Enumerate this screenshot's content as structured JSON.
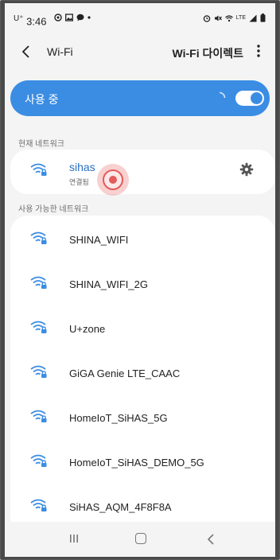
{
  "status_bar": {
    "time": "3:46",
    "carrier": "U⁺",
    "left_icons": [
      "location-icon",
      "gallery-icon",
      "chat-icon",
      "dot-icon"
    ],
    "right_icons": [
      "alarm-icon",
      "mute-icon",
      "wifi-status-icon",
      "lte-icon",
      "signal-icon",
      "battery-icon"
    ],
    "lte_label": "LTE"
  },
  "app_bar": {
    "back_label": "‹",
    "title": "Wi-Fi",
    "direct_label": "Wi-Fi 다이렉트",
    "more_label": "⋮"
  },
  "toggle": {
    "label": "사용 중",
    "state": "on",
    "accent": "#3b8de3"
  },
  "current_network": {
    "section_label": "현재 네트워크",
    "name": "sihas",
    "status": "연결됨",
    "name_color": "#2b6fc4"
  },
  "available": {
    "section_label": "사용 가능한 네트워크",
    "networks": [
      {
        "name": "SHINA_WIFI"
      },
      {
        "name": "SHINA_WIFI_2G"
      },
      {
        "name": "U+zone"
      },
      {
        "name": "GiGA Genie LTE_CAAC"
      },
      {
        "name": "HomeIoT_SiHAS_5G"
      },
      {
        "name": "HomeIoT_SiHAS_DEMO_5G"
      },
      {
        "name": "SiHAS_AQM_4F8F8A"
      }
    ]
  },
  "nav_bar": {
    "back_label": "‹"
  }
}
